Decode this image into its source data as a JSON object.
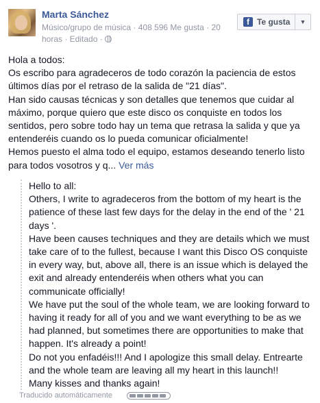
{
  "post": {
    "author": "Marta Sánchez",
    "meta_line": "Músico/grupo de música · 408 596 Me gusta · 20 horas · Editado · ",
    "globe_icon": "globe-icon",
    "like_button": {
      "label": "Te gusta",
      "icon": "facebook-icon"
    },
    "body_paragraphs": [
      "Hola a todos:\nOs escribo para agradeceros de todo corazón la paciencia de estos últimos días por el retraso de la salida de \"21 días\".\nHan sido causas técnicas y son detalles que tenemos que cuidar al máximo, porque quiero que este disco os conquiste en todos los sentidos, pero sobre todo hay un tema que retrasa la salida y que ya entenderéis cuando os lo pueda comunicar oficialmente!\nHemos puesto el alma todo el equipo, estamos deseando tenerlo listo para todos vosotros y q... "
    ],
    "see_more": "Ver más",
    "translation": "Hello to all:\nOthers, I write to agradeceros from the bottom of my heart is the patience of these last few days for the delay in the end of the ' 21 days '.\nHave been causes techniques and they are details which we must take care of to the fullest, because I want this Disco OS conquiste in every way, but, above all, there is an issue which is delayed the exit and already entenderéis when others what you can communicate officially!\nWe have put the soul of the whole team, we are looking forward to having it ready for all of you and we want everything to be as we had planned, but sometimes there are opportunities to make that happen. It's already a point!\nDo not you enfadéis!!! And I apologize this small delay. Entrearte and the whole team are leaving all my heart in this launch!!\nMany kisses and thanks again!",
    "translated_by": "Traducido automáticamente",
    "rating": {
      "filled_segments": 5,
      "total_segments": 5
    }
  }
}
